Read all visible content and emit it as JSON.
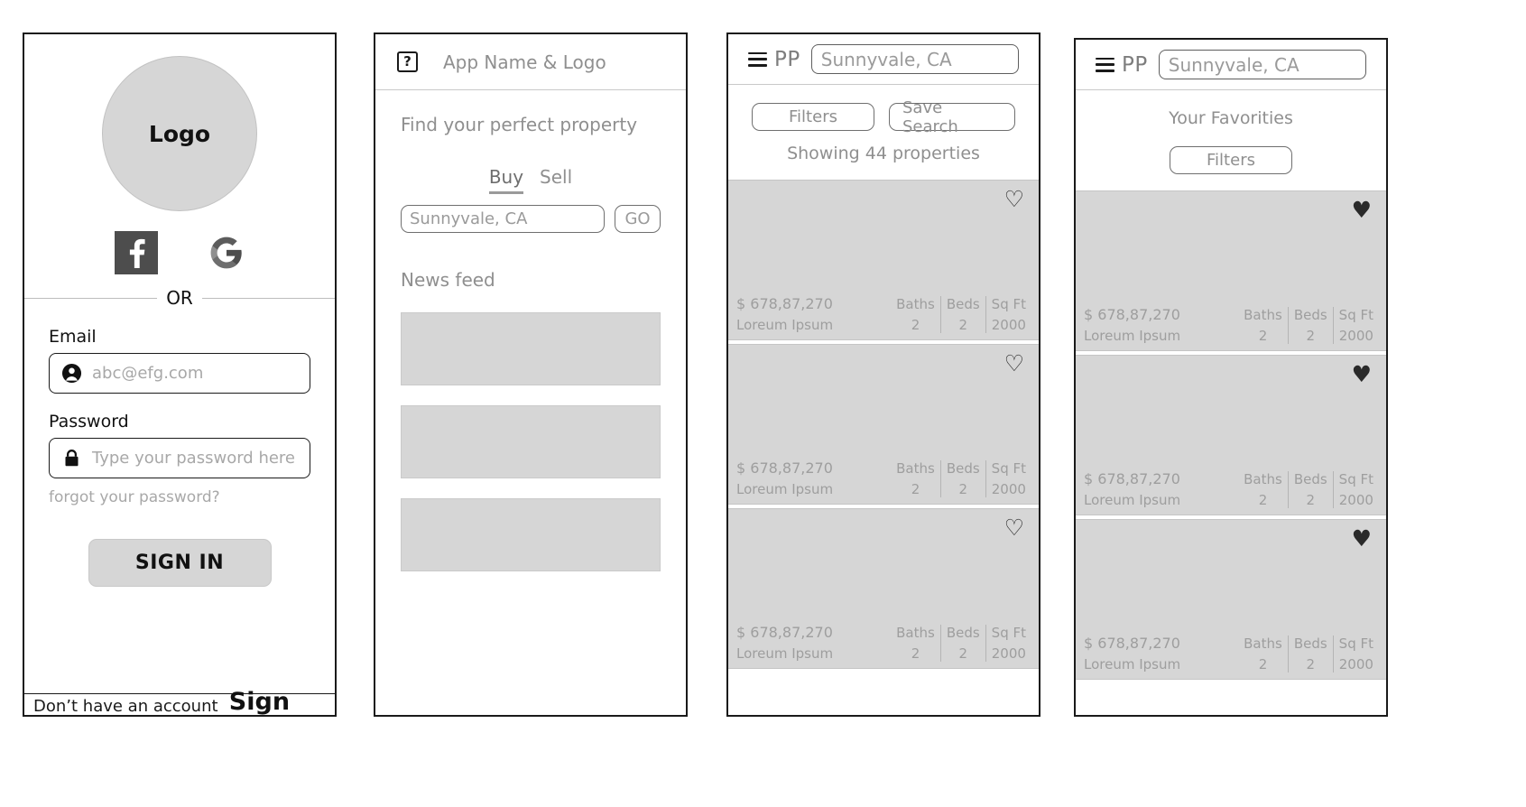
{
  "screen1": {
    "logo_text": "Logo",
    "social": {
      "facebook_name": "facebook-icon",
      "google_name": "google-icon"
    },
    "or_text": "OR",
    "email_label": "Email",
    "email_placeholder": "abc@efg.com",
    "password_label": "Password",
    "password_placeholder": "Type your password here",
    "forgot_text": "forgot your password?",
    "signin_label": "SIGN IN",
    "footer_question": "Don’t have an account ?",
    "footer_action": "Sign Up"
  },
  "screen2": {
    "help_icon_glyph": "?",
    "app_title": "App Name & Logo",
    "tagline": "Find your perfect property",
    "tabs": [
      {
        "label": "Buy",
        "active": true
      },
      {
        "label": "Sell",
        "active": false
      }
    ],
    "search_value": "Sunnyvale, CA",
    "go_label": "GO",
    "newsfeed_label": "News feed",
    "feed_cards": [
      1,
      2,
      3
    ]
  },
  "screen3": {
    "logo_text": "PP",
    "location_value": "Sunnyvale, CA",
    "filters_label": "Filters",
    "save_search_label": "Save Search",
    "showing_text": "Showing 44 properties",
    "cards": [
      {
        "price": "$ 678,87,270",
        "subtitle": "Loreum Ipsum",
        "favorited": false,
        "stats": [
          {
            "label": "Baths",
            "value": "2"
          },
          {
            "label": "Beds",
            "value": "2"
          },
          {
            "label": "Sq Ft",
            "value": "2000"
          }
        ]
      },
      {
        "price": "$ 678,87,270",
        "subtitle": "Loreum Ipsum",
        "favorited": false,
        "stats": [
          {
            "label": "Baths",
            "value": "2"
          },
          {
            "label": "Beds",
            "value": "2"
          },
          {
            "label": "Sq Ft",
            "value": "2000"
          }
        ]
      },
      {
        "price": "$ 678,87,270",
        "subtitle": "Loreum Ipsum",
        "favorited": false,
        "stats": [
          {
            "label": "Baths",
            "value": "2"
          },
          {
            "label": "Beds",
            "value": "2"
          },
          {
            "label": "Sq Ft",
            "value": "2000"
          }
        ]
      }
    ]
  },
  "screen4": {
    "logo_text": "PP",
    "location_value": "Sunnyvale, CA",
    "page_title": "Your Favorities",
    "filters_label": "Filters",
    "cards": [
      {
        "price": "$ 678,87,270",
        "subtitle": "Loreum Ipsum",
        "favorited": true,
        "stats": [
          {
            "label": "Baths",
            "value": "2"
          },
          {
            "label": "Beds",
            "value": "2"
          },
          {
            "label": "Sq Ft",
            "value": "2000"
          }
        ]
      },
      {
        "price": "$ 678,87,270",
        "subtitle": "Loreum Ipsum",
        "favorited": true,
        "stats": [
          {
            "label": "Baths",
            "value": "2"
          },
          {
            "label": "Beds",
            "value": "2"
          },
          {
            "label": "Sq Ft",
            "value": "2000"
          }
        ]
      },
      {
        "price": "$ 678,87,270",
        "subtitle": "Loreum Ipsum",
        "favorited": true,
        "stats": [
          {
            "label": "Baths",
            "value": "2"
          },
          {
            "label": "Beds",
            "value": "2"
          },
          {
            "label": "Sq Ft",
            "value": "2000"
          }
        ]
      }
    ]
  },
  "icons": {
    "heart_filled": "♥",
    "heart_outline": "♡"
  },
  "colors": {
    "card_fill": "#d6d6d6",
    "muted_text": "#9a9a9a",
    "border_dark": "#1a1a1a"
  }
}
